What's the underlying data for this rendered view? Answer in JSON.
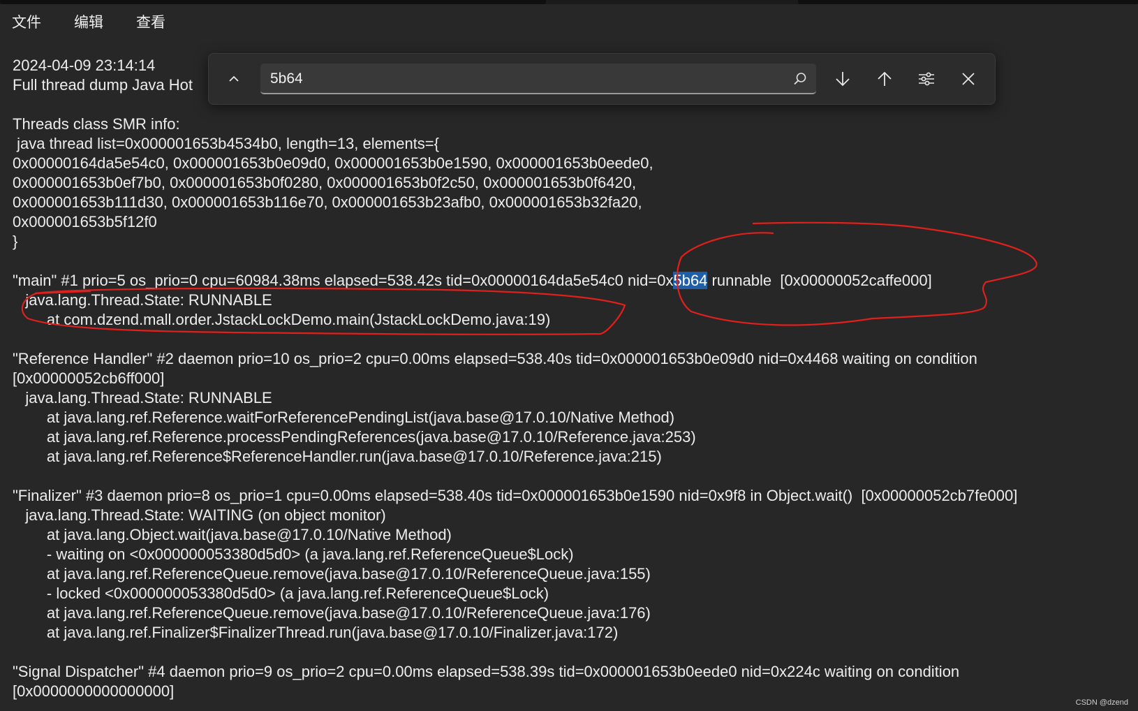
{
  "menu": {
    "file": "文件",
    "edit": "编辑",
    "view": "查看"
  },
  "find": {
    "query": "5b64"
  },
  "lines": {
    "l1": "2024-04-09 23:14:14",
    "l2": "Full thread dump Java Hot",
    "l3": "Threads class SMR info:",
    "l4": " java thread list=0x000001653b4534b0, length=13, elements={",
    "l5": "0x00000164da5e54c0, 0x000001653b0e09d0, 0x000001653b0e1590, 0x000001653b0eede0,",
    "l6": "0x000001653b0ef7b0, 0x000001653b0f0280, 0x000001653b0f2c50, 0x000001653b0f6420,",
    "l7": "0x000001653b111d30, 0x000001653b116e70, 0x000001653b23afb0, 0x000001653b32fa20,",
    "l8": "0x000001653b5f12f0",
    "l9": "}",
    "l10_pre": "\"main\" #1 prio=5 os_prio=0 cpu=60984.38ms elapsed=538.42s tid=0x00000164da5e54c0 nid=0x",
    "l10_match": "5b64",
    "l10_post": " runnable  [0x00000052caffe000]",
    "l11": "   java.lang.Thread.State: RUNNABLE",
    "l12": "        at com.dzend.mall.order.JstackLockDemo.main(JstackLockDemo.java:19)",
    "l13": "\"Reference Handler\" #2 daemon prio=10 os_prio=2 cpu=0.00ms elapsed=538.40s tid=0x000001653b0e09d0 nid=0x4468 waiting on condition",
    "l14": "[0x00000052cb6ff000]",
    "l15": "   java.lang.Thread.State: RUNNABLE",
    "l16": "        at java.lang.ref.Reference.waitForReferencePendingList(java.base@17.0.10/Native Method)",
    "l17": "        at java.lang.ref.Reference.processPendingReferences(java.base@17.0.10/Reference.java:253)",
    "l18": "        at java.lang.ref.Reference$ReferenceHandler.run(java.base@17.0.10/Reference.java:215)",
    "l19": "\"Finalizer\" #3 daemon prio=8 os_prio=1 cpu=0.00ms elapsed=538.40s tid=0x000001653b0e1590 nid=0x9f8 in Object.wait()  [0x00000052cb7fe000]",
    "l20": "   java.lang.Thread.State: WAITING (on object monitor)",
    "l21": "        at java.lang.Object.wait(java.base@17.0.10/Native Method)",
    "l22": "        - waiting on <0x000000053380d5d0> (a java.lang.ref.ReferenceQueue$Lock)",
    "l23": "        at java.lang.ref.ReferenceQueue.remove(java.base@17.0.10/ReferenceQueue.java:155)",
    "l24": "        - locked <0x000000053380d5d0> (a java.lang.ref.ReferenceQueue$Lock)",
    "l25": "        at java.lang.ref.ReferenceQueue.remove(java.base@17.0.10/ReferenceQueue.java:176)",
    "l26": "        at java.lang.ref.Finalizer$FinalizerThread.run(java.base@17.0.10/Finalizer.java:172)",
    "l27": "\"Signal Dispatcher\" #4 daemon prio=9 os_prio=2 cpu=0.00ms elapsed=538.39s tid=0x000001653b0eede0 nid=0x224c waiting on condition",
    "l28": "[0x0000000000000000]"
  },
  "watermark": "CSDN @dzend",
  "colors": {
    "background": "#272727",
    "highlight": "#1f5fa8",
    "annotation": "#e0201c"
  }
}
